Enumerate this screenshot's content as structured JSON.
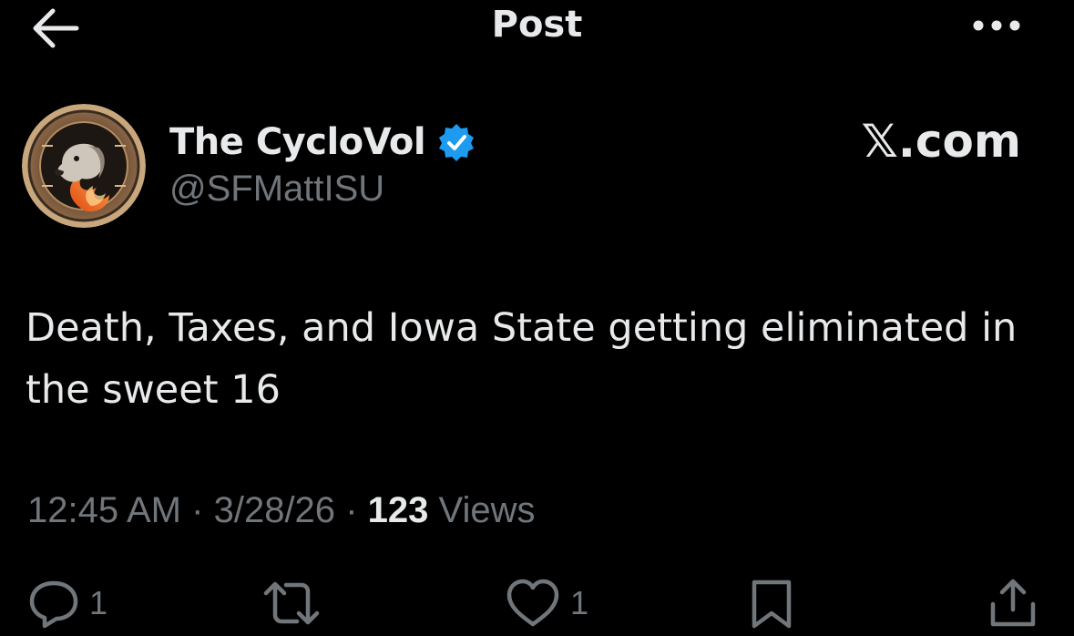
{
  "header": {
    "title": "Post",
    "back_icon": "arrow-left-icon",
    "more_icon": "more-horizontal-icon"
  },
  "author": {
    "display_name": "The CycloVol",
    "handle": "@SFMattISU",
    "verified": true,
    "verified_color": "#1d9bf0"
  },
  "brand": {
    "label": "𝕏.com"
  },
  "tweet": {
    "text": "Death, Taxes, and Iowa State getting eliminated in the sweet 16"
  },
  "meta": {
    "time": "12:45 AM",
    "separator": "·",
    "date": "3/28/26",
    "views_count": "123",
    "views_label": "Views"
  },
  "actions": {
    "reply_count": "1",
    "like_count": "1"
  },
  "colors": {
    "background": "#000000",
    "text_primary": "#e7e9ea",
    "text_secondary": "#71767b",
    "accent": "#1d9bf0"
  }
}
